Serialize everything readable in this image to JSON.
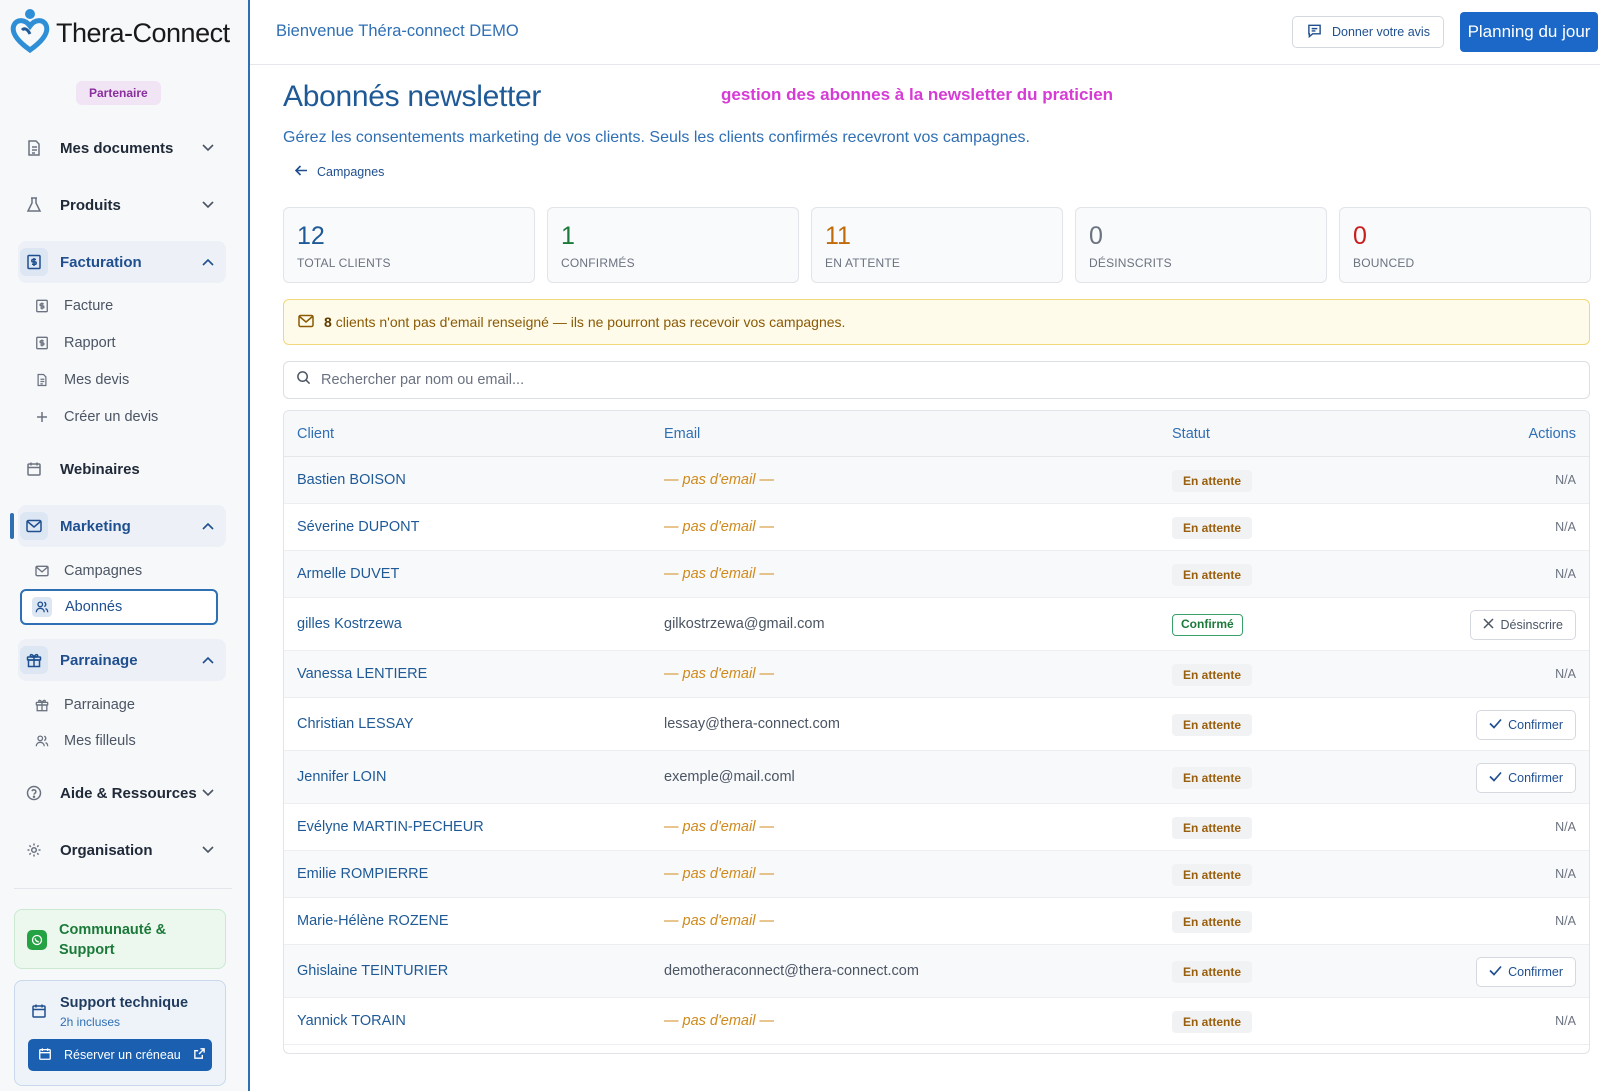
{
  "app": {
    "logo_text": "Thera-Connect",
    "partner_badge": "Partenaire"
  },
  "sidebar": {
    "items": [
      {
        "label": "Mes documents",
        "icon": "document-icon",
        "state": "collapsed"
      },
      {
        "label": "Produits",
        "icon": "flask-icon",
        "state": "collapsed"
      },
      {
        "label": "Facturation",
        "icon": "invoice-icon",
        "state": "expanded"
      },
      {
        "label": "Webinaires",
        "icon": "calendar-icon",
        "state": "none"
      },
      {
        "label": "Marketing",
        "icon": "mail-icon",
        "state": "expanded"
      },
      {
        "label": "Parrainage",
        "icon": "gift-icon",
        "state": "expanded"
      },
      {
        "label": "Aide & Ressources",
        "icon": "help-circle-icon",
        "state": "collapsed"
      },
      {
        "label": "Organisation",
        "icon": "gear-icon",
        "state": "collapsed"
      }
    ],
    "facturation_sub": [
      {
        "label": "Facture",
        "icon": "invoice-icon"
      },
      {
        "label": "Rapport",
        "icon": "invoice-icon"
      },
      {
        "label": "Mes devis",
        "icon": "document-icon"
      },
      {
        "label": "Créer un devis",
        "icon": "plus-icon"
      }
    ],
    "marketing_sub": [
      {
        "label": "Campagnes",
        "icon": "mail-icon"
      },
      {
        "label": "Abonnés",
        "icon": "users-icon",
        "selected": true
      }
    ],
    "parrainage_sub": [
      {
        "label": "Parrainage",
        "icon": "gift-icon"
      },
      {
        "label": "Mes filleuls",
        "icon": "users-icon"
      }
    ],
    "community_label": "Communauté & Support",
    "support": {
      "title": "Support technique",
      "subtitle": "2h incluses",
      "button": "Réserver un créneau"
    }
  },
  "header": {
    "welcome": "Bienvenue Théra-connect DEMO",
    "feedback_button": "Donner votre avis",
    "planning_button": "Planning du jour"
  },
  "main": {
    "title": "Abonnés newsletter",
    "annotation": "gestion des abonnes à la newsletter du praticien",
    "subtitle": "Gérez les consentements marketing de vos clients. Seuls les clients confirmés recevront vos campagnes.",
    "back_link": "Campagnes",
    "stats": [
      {
        "value": "12",
        "label": "TOTAL CLIENTS",
        "color": "#1f5a97"
      },
      {
        "value": "1",
        "label": "CONFIRMÉS",
        "color": "#1b7a3a"
      },
      {
        "value": "11",
        "label": "EN ATTENTE",
        "color": "#c06a0a"
      },
      {
        "value": "0",
        "label": "DÉSINSCRITS",
        "color": "#6b7280"
      },
      {
        "value": "0",
        "label": "BOUNCED",
        "color": "#c81e1e"
      }
    ],
    "warning": {
      "count": "8",
      "text": "clients n'ont pas d'email renseigné — ils ne pourront pas recevoir vos campagnes."
    },
    "search_placeholder": "Rechercher par nom ou email...",
    "table": {
      "columns": [
        "Client",
        "Email",
        "Statut",
        "Actions"
      ],
      "rows": [
        {
          "client": "Bastien BOISON",
          "email": "— pas d'email —",
          "has_email": false,
          "status": "En attente",
          "status_type": "pending",
          "action": "N/A"
        },
        {
          "client": "Séverine DUPONT",
          "email": "— pas d'email —",
          "has_email": false,
          "status": "En attente",
          "status_type": "pending",
          "action": "N/A"
        },
        {
          "client": "Armelle DUVET",
          "email": "— pas d'email —",
          "has_email": false,
          "status": "En attente",
          "status_type": "pending",
          "action": "N/A"
        },
        {
          "client": "gilles Kostrzewa",
          "email": "gilkostrzewa@gmail.com",
          "has_email": true,
          "status": "Confirmé",
          "status_type": "confirmed",
          "action": "Désinscrire"
        },
        {
          "client": "Vanessa LENTIERE",
          "email": "— pas d'email —",
          "has_email": false,
          "status": "En attente",
          "status_type": "pending",
          "action": "N/A"
        },
        {
          "client": "Christian LESSAY",
          "email": "lessay@thera-connect.com",
          "has_email": true,
          "status": "En attente",
          "status_type": "pending",
          "action": "Confirmer"
        },
        {
          "client": "Jennifer LOIN",
          "email": "exemple@mail.coml",
          "has_email": true,
          "status": "En attente",
          "status_type": "pending",
          "action": "Confirmer"
        },
        {
          "client": "Evélyne MARTIN-PECHEUR",
          "email": "— pas d'email —",
          "has_email": false,
          "status": "En attente",
          "status_type": "pending",
          "action": "N/A"
        },
        {
          "client": "Emilie ROMPIERRE",
          "email": "— pas d'email —",
          "has_email": false,
          "status": "En attente",
          "status_type": "pending",
          "action": "N/A"
        },
        {
          "client": "Marie-Hélène ROZENE",
          "email": "— pas d'email —",
          "has_email": false,
          "status": "En attente",
          "status_type": "pending",
          "action": "N/A"
        },
        {
          "client": "Ghislaine TEINTURIER",
          "email": "demotheraconnect@thera-connect.com",
          "has_email": true,
          "status": "En attente",
          "status_type": "pending",
          "action": "Confirmer"
        },
        {
          "client": "Yannick TORAIN",
          "email": "— pas d'email —",
          "has_email": false,
          "status": "En attente",
          "status_type": "pending",
          "action": "N/A"
        }
      ]
    }
  },
  "colors": {
    "primary": "#1f5a97",
    "accent": "#1b68c8",
    "annotation": "#d63bd6",
    "warning_bg": "#fffbea"
  }
}
